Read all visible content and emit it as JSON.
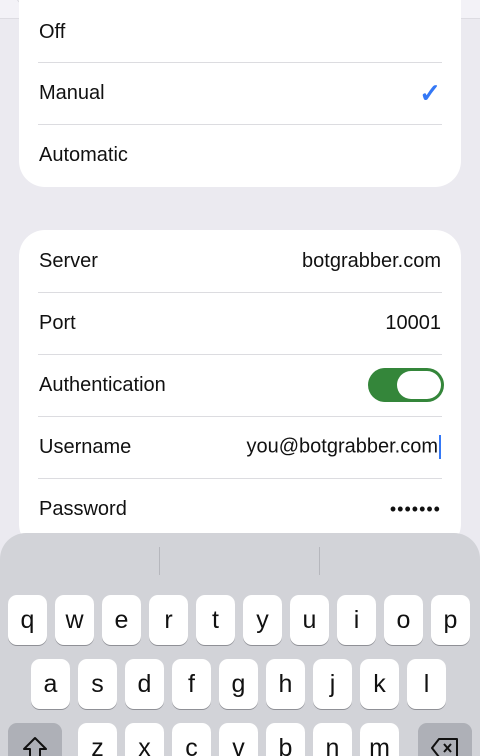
{
  "proxy_mode": {
    "options": [
      {
        "label": "Off",
        "selected": false
      },
      {
        "label": "Manual",
        "selected": true
      },
      {
        "label": "Automatic",
        "selected": false
      }
    ],
    "check_icon": "checkmark-icon",
    "accent": "#3478f6"
  },
  "proxy_settings": {
    "server_label": "Server",
    "server_value": "botgrabber.com",
    "port_label": "Port",
    "port_value": "10001",
    "auth_label": "Authentication",
    "auth_enabled": true,
    "toggle_color": "#34863a",
    "username_label": "Username",
    "username_value": "you@botgrabber.com",
    "password_label": "Password",
    "password_value": "•••••••"
  },
  "keyboard": {
    "row1": [
      "q",
      "w",
      "e",
      "r",
      "t",
      "y",
      "u",
      "i",
      "o",
      "p"
    ],
    "row2": [
      "a",
      "s",
      "d",
      "f",
      "g",
      "h",
      "j",
      "k",
      "l"
    ],
    "row3": [
      "z",
      "x",
      "c",
      "v",
      "b",
      "n",
      "m"
    ],
    "shift_icon": "shift-icon",
    "delete_icon": "delete-icon"
  }
}
